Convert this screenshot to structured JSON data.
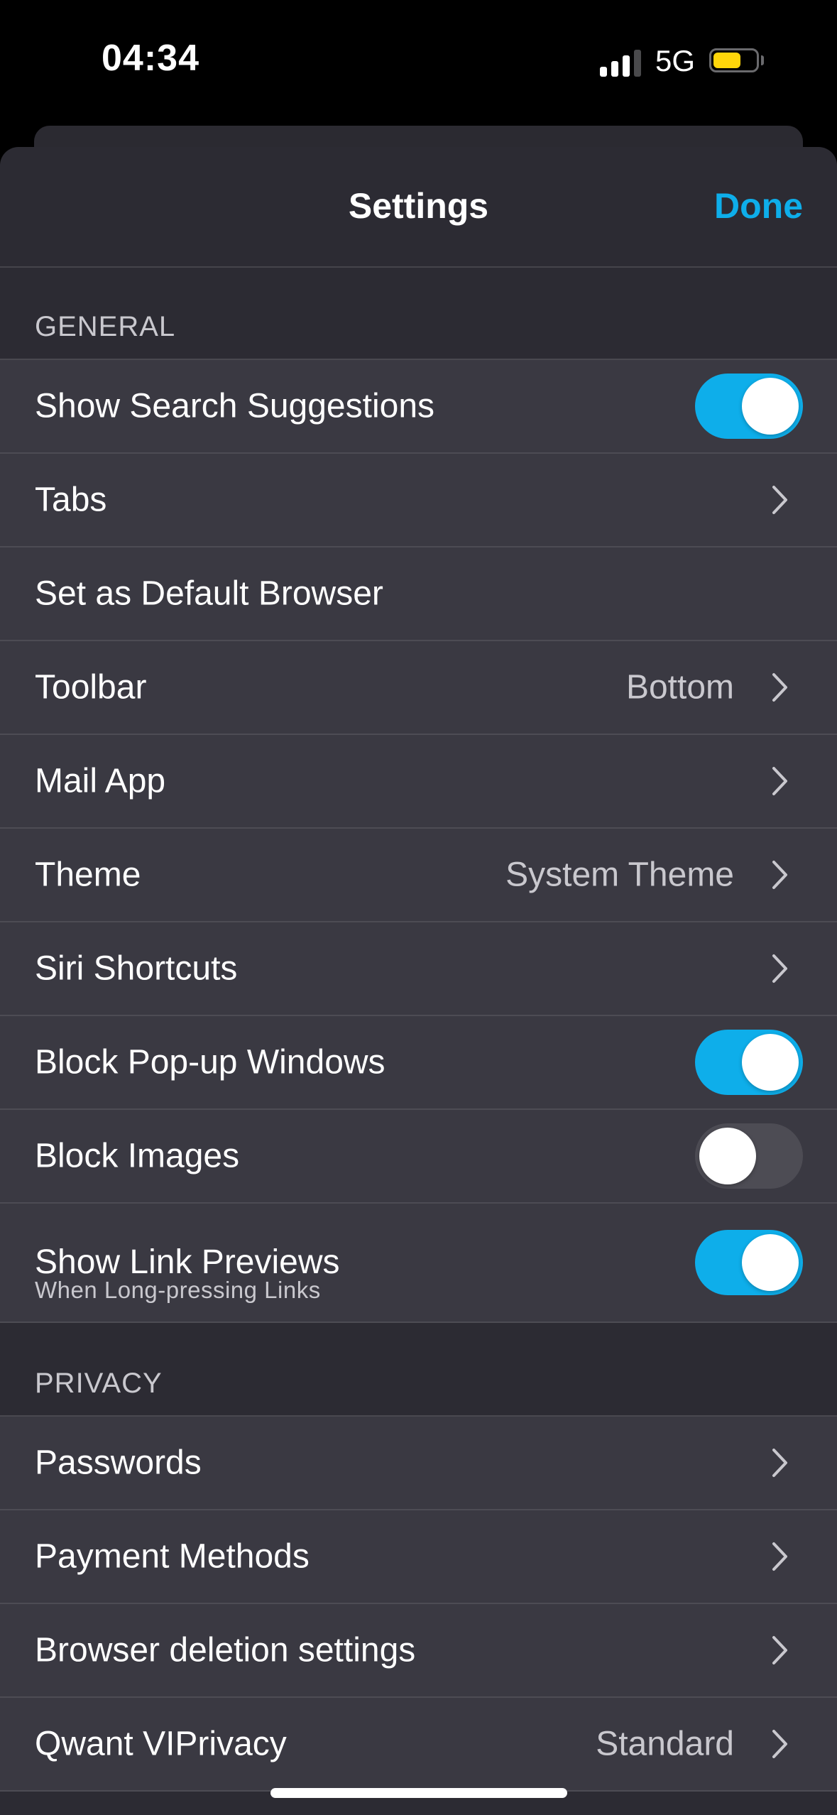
{
  "status_bar": {
    "time": "04:34",
    "network": "5G",
    "signal_bars_active": 3,
    "signal_bars_total": 4,
    "battery_level": 0.65,
    "battery_color": "#ffd60a"
  },
  "nav": {
    "title": "Settings",
    "done_label": "Done",
    "accent_color": "#0eaeea"
  },
  "sections": {
    "general": {
      "header": "GENERAL",
      "rows": [
        {
          "label": "Show Search Suggestions",
          "type": "toggle",
          "on": true
        },
        {
          "label": "Tabs",
          "type": "disclosure"
        },
        {
          "label": "Set as Default Browser",
          "type": "plain"
        },
        {
          "label": "Toolbar",
          "type": "disclosure",
          "value": "Bottom"
        },
        {
          "label": "Mail App",
          "type": "disclosure"
        },
        {
          "label": "Theme",
          "type": "disclosure",
          "value": "System Theme"
        },
        {
          "label": "Siri Shortcuts",
          "type": "disclosure"
        },
        {
          "label": "Block Pop-up Windows",
          "type": "toggle",
          "on": true
        },
        {
          "label": "Block Images",
          "type": "toggle",
          "on": false
        },
        {
          "label": "Show Link Previews",
          "sublabel": "When Long-pressing Links",
          "type": "toggle",
          "on": true
        }
      ]
    },
    "privacy": {
      "header": "PRIVACY",
      "rows": [
        {
          "label": "Passwords",
          "type": "disclosure"
        },
        {
          "label": "Payment Methods",
          "type": "disclosure"
        },
        {
          "label": "Browser deletion settings",
          "type": "disclosure"
        },
        {
          "label": "Qwant VIPrivacy",
          "type": "disclosure",
          "value": "Standard"
        }
      ]
    }
  },
  "icons": {
    "chevron": "chevron-right-icon",
    "signal": "cellular-signal-icon",
    "battery": "battery-icon"
  }
}
